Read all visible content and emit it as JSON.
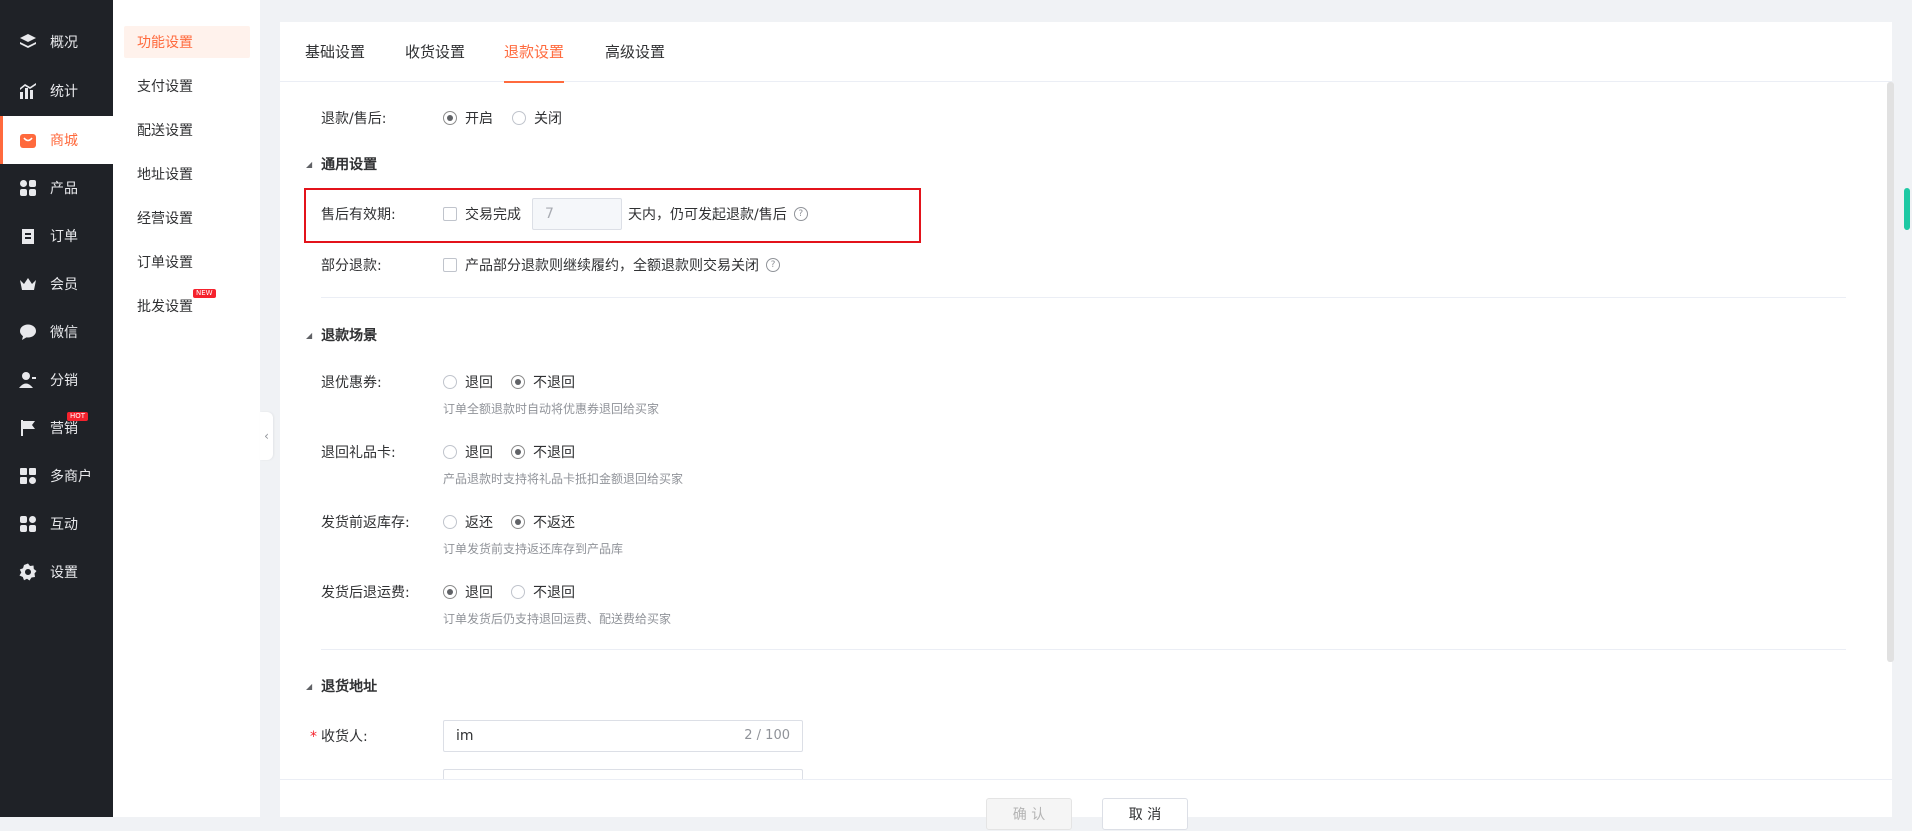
{
  "nav": {
    "items": [
      {
        "label": "概况",
        "icon": "layers-icon"
      },
      {
        "label": "统计",
        "icon": "chart-icon"
      },
      {
        "label": "商城",
        "icon": "shop-bag-icon"
      },
      {
        "label": "产品",
        "icon": "grid-icon"
      },
      {
        "label": "订单",
        "icon": "clipboard-icon"
      },
      {
        "label": "会员",
        "icon": "crown-icon"
      },
      {
        "label": "微信",
        "icon": "wechat-icon"
      },
      {
        "label": "分销",
        "icon": "user-share-icon"
      },
      {
        "label": "营销",
        "icon": "flag-icon",
        "badge": "HOT"
      },
      {
        "label": "多商户",
        "icon": "store-icon"
      },
      {
        "label": "互动",
        "icon": "interact-icon"
      },
      {
        "label": "设置",
        "icon": "gear-icon"
      }
    ],
    "active": "商城"
  },
  "submenu": {
    "items": [
      {
        "label": "功能设置"
      },
      {
        "label": "支付设置"
      },
      {
        "label": "配送设置"
      },
      {
        "label": "地址设置"
      },
      {
        "label": "经营设置"
      },
      {
        "label": "订单设置"
      },
      {
        "label": "批发设置",
        "badge": "NEW"
      }
    ],
    "active": "功能设置"
  },
  "tabs": [
    {
      "label": "基础设置"
    },
    {
      "label": "收货设置"
    },
    {
      "label": "退款设置"
    },
    {
      "label": "高级设置"
    }
  ],
  "active_tab": "退款设置",
  "refund": {
    "label": "退款/售后:",
    "on": "开启",
    "off": "关闭",
    "selected": "开启"
  },
  "general": {
    "title": "通用设置",
    "validity": {
      "label": "售后有效期:",
      "checkbox_label": "交易完成",
      "days": "7",
      "suffix": "天内，仍可发起退款/售后"
    },
    "partial": {
      "label": "部分退款:",
      "checkbox_label": "产品部分退款则继续履约，全额退款则交易关闭"
    }
  },
  "scenes": {
    "title": "退款场景",
    "coupon": {
      "label": "退优惠券:",
      "opt1": "退回",
      "opt2": "不退回",
      "selected": "不退回",
      "hint": "订单全额退款时自动将优惠券退回给买家"
    },
    "giftcard": {
      "label": "退回礼品卡:",
      "opt1": "退回",
      "opt2": "不退回",
      "selected": "不退回",
      "hint": "产品退款时支持将礼品卡抵扣金额退回给买家"
    },
    "stock": {
      "label": "发货前返库存:",
      "opt1": "返还",
      "opt2": "不返还",
      "selected": "不返还",
      "hint": "订单发货前支持返还库存到产品库"
    },
    "shipping": {
      "label": "发货后退运费:",
      "opt1": "退回",
      "opt2": "不退回",
      "selected": "退回",
      "hint": "订单发货后仍支持退回运费、配送费给买家"
    }
  },
  "address": {
    "title": "退货地址",
    "receiver_label": "收货人:",
    "receiver_value": "im",
    "receiver_count": "2 / 100"
  },
  "footer": {
    "confirm": "确 认",
    "cancel": "取 消"
  },
  "colors": {
    "accent": "#ff6a3d",
    "nav_bg": "#1f2227",
    "highlight": "#e3131b"
  }
}
